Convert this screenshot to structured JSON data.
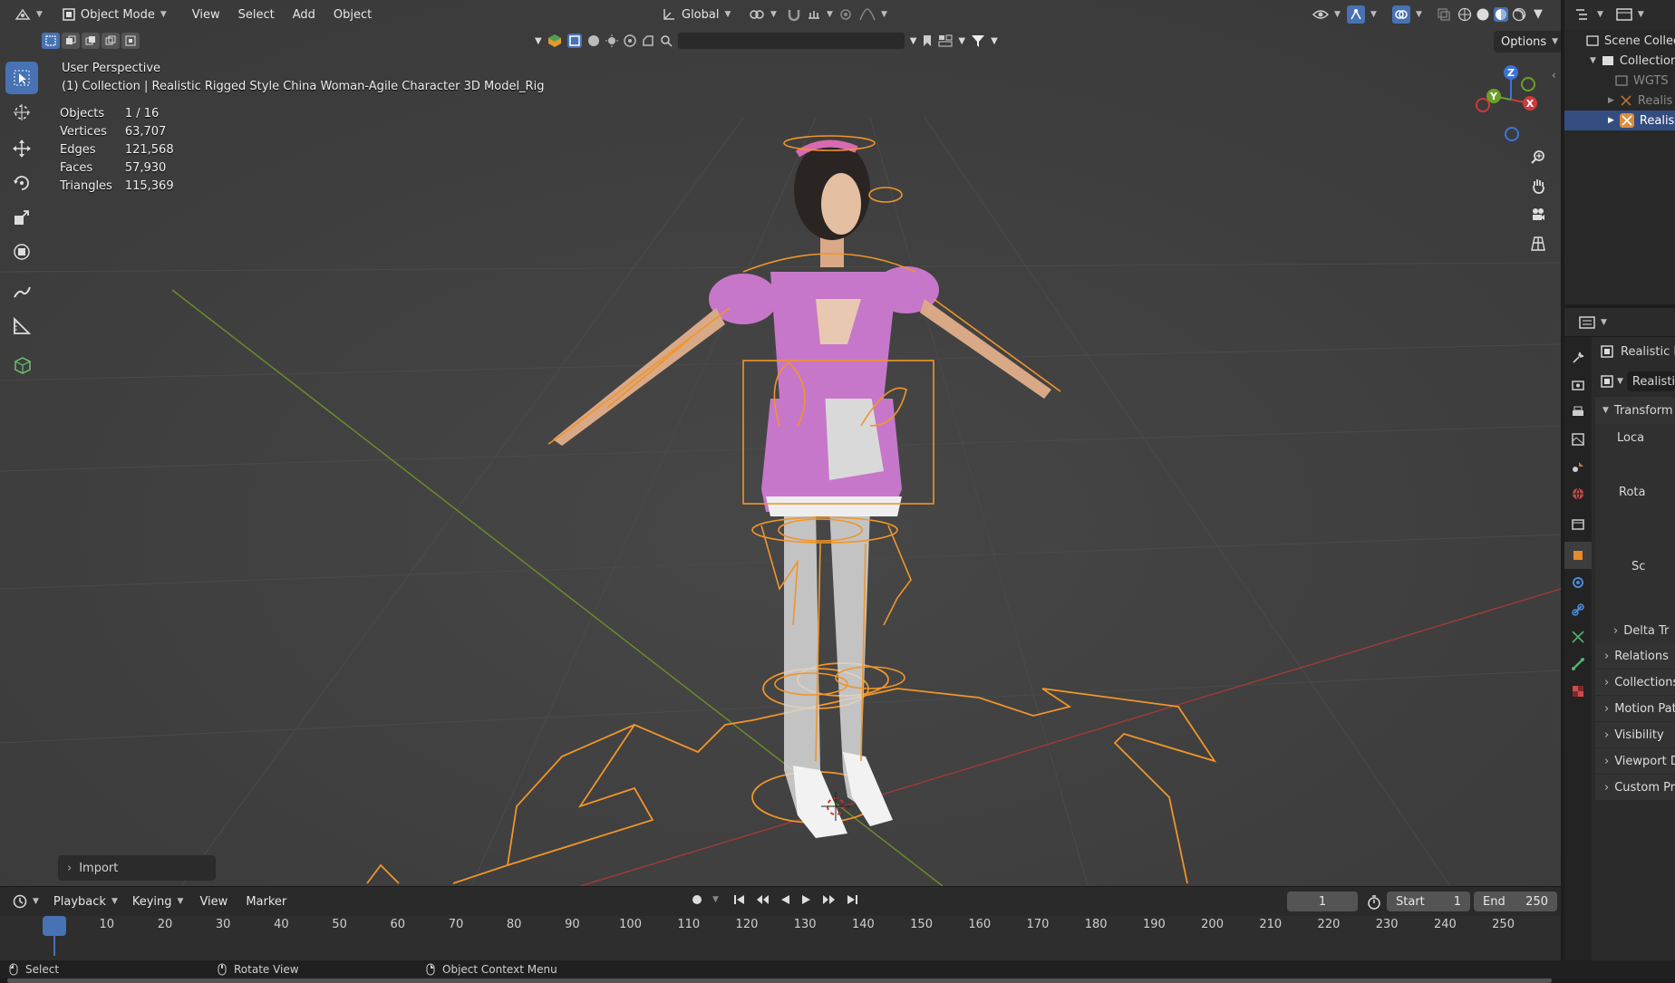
{
  "header": {
    "mode_label": "Object Mode",
    "menu": [
      "View",
      "Select",
      "Add",
      "Object"
    ],
    "transform_orientation": "Global",
    "options_label": "Options"
  },
  "overlay": {
    "view_name": "User Perspective",
    "collection_line": "(1) Collection | Realistic Rigged Style China Woman-Agile Character 3D Model_Rig",
    "stats": [
      {
        "label": "Objects",
        "value": "1 / 16"
      },
      {
        "label": "Vertices",
        "value": "63,707"
      },
      {
        "label": "Edges",
        "value": "121,568"
      },
      {
        "label": "Faces",
        "value": "57,930"
      },
      {
        "label": "Triangles",
        "value": "115,369"
      }
    ]
  },
  "import_panel": {
    "label": "Import"
  },
  "timeline": {
    "menu": [
      "Playback",
      "Keying",
      "View",
      "Marker"
    ],
    "current_frame": "1",
    "start_label": "Start",
    "start_value": "1",
    "end_label": "End",
    "end_value": "250",
    "ruler": [
      "1",
      "10",
      "20",
      "30",
      "40",
      "50",
      "60",
      "70",
      "80",
      "90",
      "100",
      "110",
      "120",
      "130",
      "140",
      "150",
      "160",
      "170",
      "180",
      "190",
      "200",
      "210",
      "220",
      "230",
      "240",
      "250"
    ]
  },
  "statusbar": {
    "items": [
      "Select",
      "Rotate View",
      "Object Context Menu"
    ]
  },
  "outliner": {
    "rows": [
      "Scene Collect",
      "Collection",
      "WGTS",
      "Realis",
      "Realis"
    ]
  },
  "properties": {
    "object_name": "Realistic R",
    "data_name": "Realisti",
    "transform_label": "Transform",
    "location_label": "Loca",
    "rotation_label": "Rota",
    "scale_label": "Sc",
    "delta_label": "Delta Tr",
    "panels": [
      "Relations",
      "Collections",
      "Motion Pat",
      "Visibility",
      "Viewport D",
      "Custom Pro"
    ]
  },
  "colors": {
    "accent": "#4772b3",
    "rig": "#f0952a",
    "x_axis": "#9a3b3b",
    "y_axis": "#6a8a2a"
  }
}
